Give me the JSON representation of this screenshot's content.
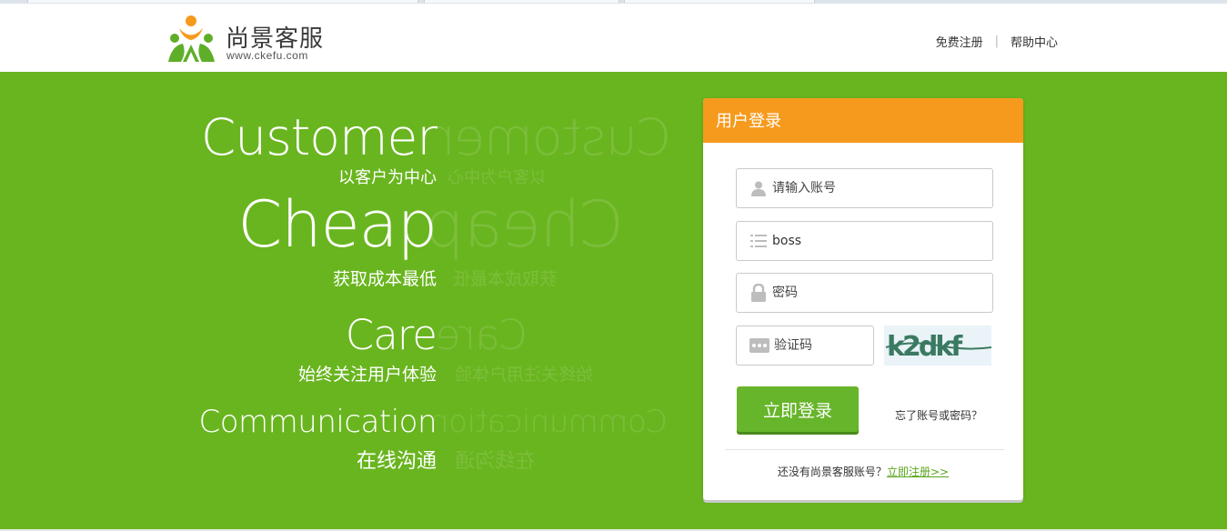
{
  "header": {
    "brand_name": "尚景客服",
    "brand_url": "www.ckefu.com",
    "links": {
      "register": "免费注册",
      "separator": "|",
      "help": "帮助中心"
    }
  },
  "slogans": [
    {
      "en": "Customer",
      "cn": "以客户为中心"
    },
    {
      "en": "Cheap",
      "cn": "获取成本最低"
    },
    {
      "en": "Care",
      "cn": "始终关注用户体验"
    },
    {
      "en": "Communication",
      "cn": "在线沟通"
    }
  ],
  "login": {
    "title": "用户登录",
    "account": {
      "placeholder": "请输入账号",
      "value": ""
    },
    "company": {
      "placeholder": "",
      "value": "boss"
    },
    "password": {
      "placeholder": "密码",
      "value": ""
    },
    "captcha": {
      "placeholder": "验证码",
      "value": "",
      "image_text": "k2dkf"
    },
    "submit_label": "立即登录",
    "forgot_label": "忘了账号或密码？",
    "register_prompt": "还没有尚景客服账号？",
    "register_link": "立即注册>>"
  },
  "colors": {
    "banner_green": "#69b51f",
    "panel_orange": "#f69a1d",
    "button_green": "#67b52a",
    "link_green": "#5aa51b"
  },
  "icons": [
    "logo-people-icon",
    "user-icon",
    "list-icon",
    "lock-icon",
    "dots-icon"
  ]
}
